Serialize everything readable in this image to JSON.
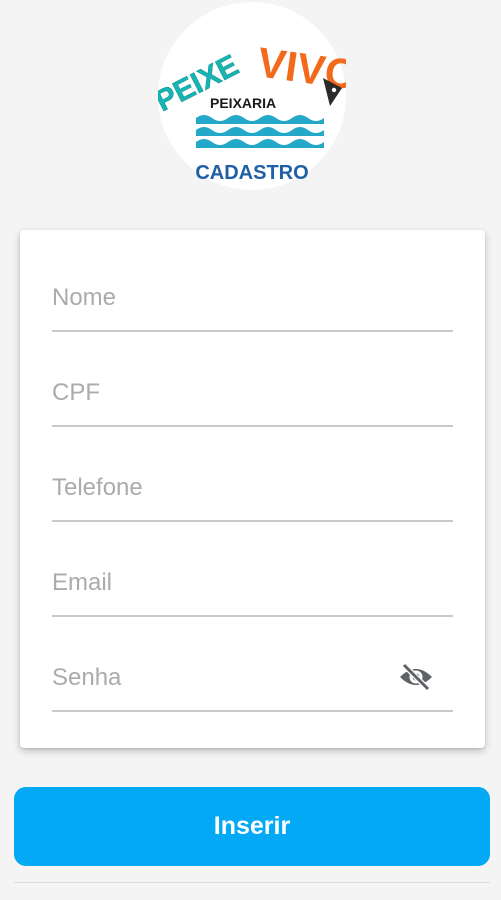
{
  "logo": {
    "word_left": "PEIXE",
    "word_right": "VIVO",
    "subtitle": "PEIXARIA",
    "caption": "CADASTRO"
  },
  "form": {
    "nome_placeholder": "Nome",
    "cpf_placeholder": "CPF",
    "telefone_placeholder": "Telefone",
    "email_placeholder": "Email",
    "senha_placeholder": "Senha",
    "password_toggle_icon": "eye-off-icon"
  },
  "actions": {
    "submit_label": "Inserir"
  },
  "colors": {
    "accent": "#03a9f4",
    "logo_teal": "#17b4b4",
    "logo_orange": "#f26a1b",
    "logo_blue": "#1f5fa6"
  }
}
